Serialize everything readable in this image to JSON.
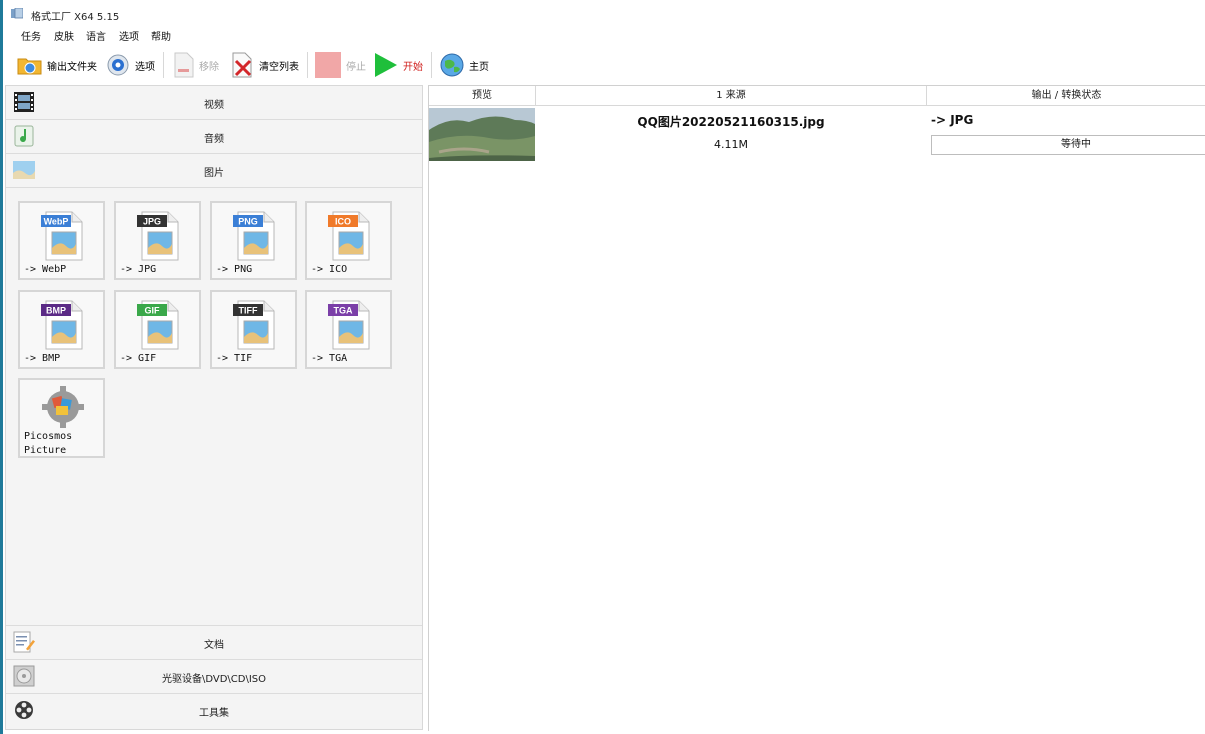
{
  "window": {
    "title": "格式工厂 X64 5.15"
  },
  "menu": [
    "任务",
    "皮肤",
    "语言",
    "选项",
    "帮助"
  ],
  "toolbar": {
    "output_folder": "输出文件夹",
    "options": "选项",
    "remove": "移除",
    "clear_list": "清空列表",
    "stop": "停止",
    "start": "开始",
    "home": "主页"
  },
  "categories": {
    "video": "视频",
    "audio": "音频",
    "image": "图片",
    "document": "文档",
    "optical": "光驱设备\\DVD\\CD\\ISO",
    "tools": "工具集"
  },
  "formats": [
    {
      "badge": "WebP",
      "label": "-> WebP",
      "badge_color": "#3b7fd6"
    },
    {
      "badge": "JPG",
      "label": "-> JPG",
      "badge_color": "#333333"
    },
    {
      "badge": "PNG",
      "label": "-> PNG",
      "badge_color": "#3b7fd6"
    },
    {
      "badge": "ICO",
      "label": "-> ICO",
      "badge_color": "#f07a2a"
    },
    {
      "badge": "BMP",
      "label": "-> BMP",
      "badge_color": "#5b2a86"
    },
    {
      "badge": "GIF",
      "label": "-> GIF",
      "badge_color": "#3aa84a"
    },
    {
      "badge": "TIFF",
      "label": "-> TIF",
      "badge_color": "#333333"
    },
    {
      "badge": "TGA",
      "label": "-> TGA",
      "badge_color": "#7b3fa8"
    }
  ],
  "picosmos": {
    "label": "Picosmos Picture"
  },
  "table": {
    "headers": {
      "preview": "预览",
      "source": "1 来源",
      "status": "输出 / 转换状态"
    },
    "rows": [
      {
        "source_name": "QQ图片20220521160315.jpg",
        "size": "4.11M",
        "output": "-> JPG",
        "status": "等待中"
      }
    ]
  }
}
